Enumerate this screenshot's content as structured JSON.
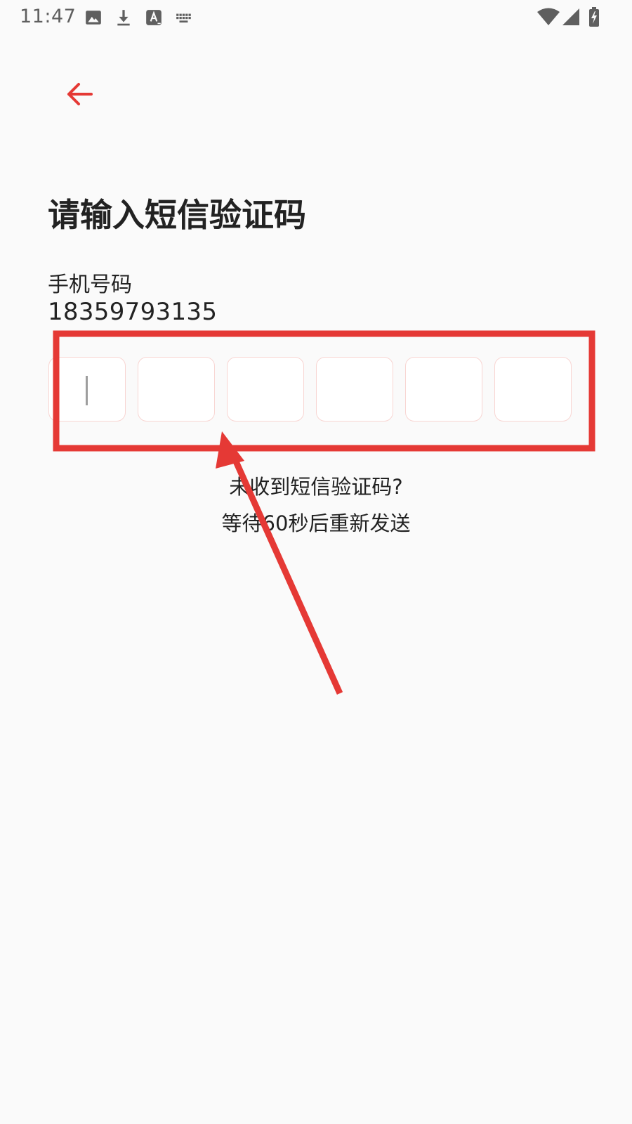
{
  "status_bar": {
    "time": "11:47",
    "icons_left": [
      "image-icon",
      "download-icon",
      "text-a-icon",
      "keyboard-icon"
    ],
    "icons_right": [
      "wifi-icon",
      "cell-signal-icon",
      "battery-charging-icon"
    ]
  },
  "header": {
    "back_icon": "arrow-left-icon",
    "accent_color": "#e53935"
  },
  "main": {
    "title": "请输入短信验证码",
    "phone_label": "手机号码",
    "phone_number": "18359793135",
    "code_boxes": [
      "",
      "",
      "",
      "",
      "",
      ""
    ],
    "active_box_index": 0,
    "hint_question": "未收到短信验证码?",
    "hint_countdown": "等待60秒后重新发送"
  },
  "annotation": {
    "color": "#e53935",
    "shapes": [
      "highlight-rectangle",
      "pointer-arrow"
    ]
  }
}
